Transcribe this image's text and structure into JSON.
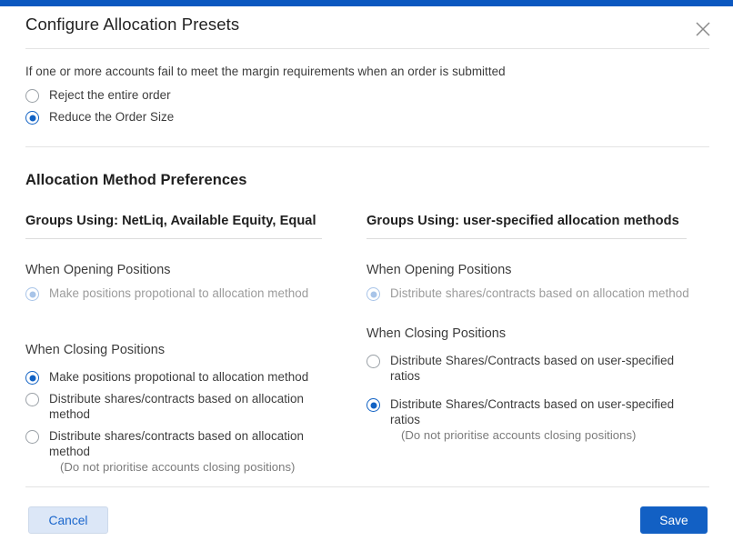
{
  "window": {
    "accent_color": "#0b58c0"
  },
  "header": {
    "title": "Configure Allocation Presets",
    "close_icon": "close-icon"
  },
  "margin_failure": {
    "note": "If one or more accounts fail to meet the margin requirements when an order is submitted",
    "options": [
      {
        "label": "Reject the entire order",
        "selected": false
      },
      {
        "label": "Reduce the Order Size",
        "selected": true
      }
    ]
  },
  "preferences": {
    "title": "Allocation Method Preferences",
    "columns": [
      {
        "heading": "Groups Using: NetLiq, Available Equity, Equal",
        "opening": {
          "label": "When Opening Positions",
          "options": [
            {
              "label": "Make positions propotional to allocation method",
              "selected": true,
              "disabled": true
            }
          ]
        },
        "closing": {
          "label": "When Closing Positions",
          "options": [
            {
              "label": "Make positions propotional to allocation method",
              "sub": "",
              "selected": true,
              "disabled": false
            },
            {
              "label": "Distribute shares/contracts based on allocation method",
              "sub": "",
              "selected": false,
              "disabled": false
            },
            {
              "label": "Distribute shares/contracts based on allocation method",
              "sub": "(Do not prioritise accounts closing positions)",
              "selected": false,
              "disabled": false
            }
          ]
        }
      },
      {
        "heading": "Groups Using: user-specified allocation methods",
        "opening": {
          "label": "When Opening Positions",
          "options": [
            {
              "label": "Distribute shares/contracts based on allocation method",
              "selected": true,
              "disabled": true
            }
          ]
        },
        "closing": {
          "label": "When Closing Positions",
          "options": [
            {
              "label": "Distribute Shares/Contracts based on user-specified ratios",
              "sub": "",
              "selected": false,
              "disabled": false
            },
            {
              "label": "Distribute Shares/Contracts based on user-specified ratios",
              "sub": "(Do not prioritise accounts closing positions)",
              "selected": true,
              "disabled": false
            }
          ]
        }
      }
    ]
  },
  "footer": {
    "cancel_label": "Cancel",
    "save_label": "Save"
  }
}
